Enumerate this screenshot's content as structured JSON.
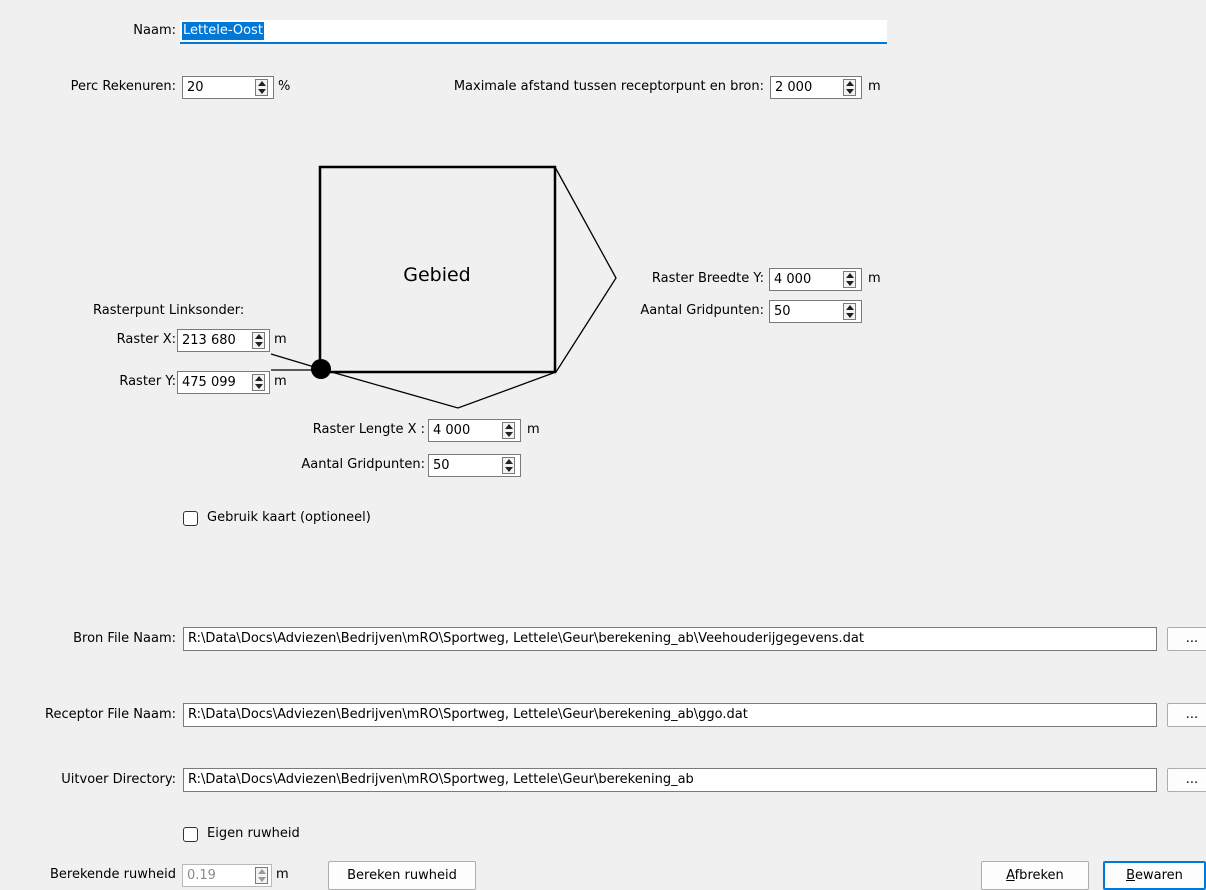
{
  "name": {
    "label": "Naam:",
    "value": "Lettele-Oost"
  },
  "perc_rekenuren": {
    "label": "Perc Rekenuren:",
    "value": "20",
    "unit": "%"
  },
  "max_afstand": {
    "label": "Maximale afstand tussen receptorpunt en bron:",
    "value": "2 000",
    "unit": "m"
  },
  "diagram": {
    "area_label": "Gebied"
  },
  "rasterpunt": {
    "heading": "Rasterpunt Linksonder:",
    "x_label": "Raster X:",
    "x_value": "213 680",
    "x_unit": "m",
    "y_label": "Raster Y:",
    "y_value": "475 099",
    "y_unit": "m"
  },
  "raster_breedte": {
    "label": "Raster Breedte Y:",
    "value": "4 000",
    "unit": "m",
    "grid_label": "Aantal Gridpunten:",
    "grid_value": "50"
  },
  "raster_lengte": {
    "label": "Raster Lengte X :",
    "value": "4 000",
    "unit": "m",
    "grid_label": "Aantal Gridpunten:",
    "grid_value": "50"
  },
  "gebruik_kaart": {
    "label": "Gebruik kaart (optioneel)",
    "checked": false
  },
  "bron_file": {
    "label": "Bron File Naam:",
    "value": "R:\\Data\\Docs\\Adviezen\\Bedrijven\\mRO\\Sportweg, Lettele\\Geur\\berekening_ab\\Veehouderijgegevens.dat",
    "browse": "..."
  },
  "receptor_file": {
    "label": "Receptor File Naam:",
    "value": "R:\\Data\\Docs\\Adviezen\\Bedrijven\\mRO\\Sportweg, Lettele\\Geur\\berekening_ab\\ggo.dat",
    "browse": "..."
  },
  "uitvoer_dir": {
    "label": "Uitvoer Directory:",
    "value": "R:\\Data\\Docs\\Adviezen\\Bedrijven\\mRO\\Sportweg, Lettele\\Geur\\berekening_ab",
    "browse": "..."
  },
  "eigen_ruwheid": {
    "label": "Eigen ruwheid",
    "checked": false
  },
  "berekende_ruwheid": {
    "label": "Berekende ruwheid",
    "value": "0.19",
    "unit": "m"
  },
  "buttons": {
    "bereken": "Bereken ruwheid",
    "afbreken_first": "A",
    "afbreken_rest": "fbreken",
    "bewaren_first": "B",
    "bewaren_rest": "ewaren"
  }
}
